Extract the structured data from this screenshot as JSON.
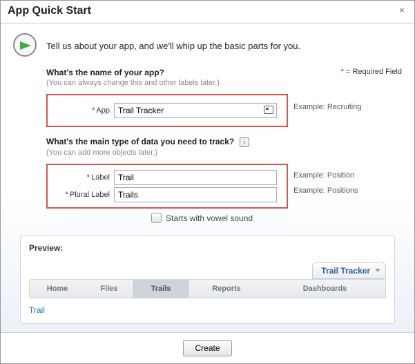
{
  "titlebar": {
    "title": "App Quick Start"
  },
  "intro": "Tell us about your app, and we'll whip up the basic parts for you.",
  "required_note": {
    "star": "*",
    "text": " = Required Field"
  },
  "section_app": {
    "question": "What's the name of your app?",
    "hint": "(You can always change this and other labels later.)",
    "field_label": "App",
    "value": "Trail Tracker",
    "example": "Example: Recruiting"
  },
  "section_obj": {
    "question": "What's the main type of data you need to track?",
    "hint": "(You can add more objects later.)",
    "label_field": {
      "label": "Label",
      "value": "Trail",
      "example": "Example: Position"
    },
    "plural_field": {
      "label": "Plural Label",
      "value": "Trails",
      "example": "Example: Positions"
    },
    "vowel": "Starts with vowel sound"
  },
  "preview": {
    "heading": "Preview:",
    "app_name": "Trail Tracker",
    "tabs": {
      "home": "Home",
      "files": "Files",
      "trails": "Trails",
      "reports": "Reports",
      "dashboards": "Dashboards"
    },
    "link": "Trail"
  },
  "footer": {
    "create": "Create"
  }
}
